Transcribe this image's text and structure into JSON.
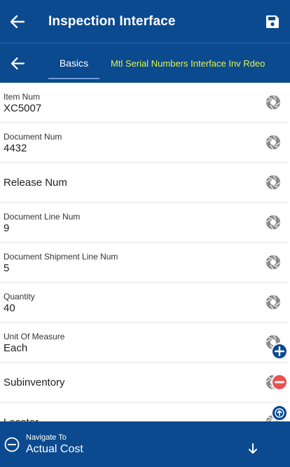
{
  "header": {
    "title": "Inspection Interface"
  },
  "tabs": {
    "basics_label": "Basics",
    "mtl_label": "Mtl Serial Numbers Interface Inv Rdeo"
  },
  "fields": [
    {
      "label": "Item Num",
      "value": "XC5007"
    },
    {
      "label": "Document Num",
      "value": "4432"
    },
    {
      "label": "Release Num",
      "value": ""
    },
    {
      "label": "Document Line Num",
      "value": "9"
    },
    {
      "label": "Document Shipment Line Num",
      "value": "5"
    },
    {
      "label": "Quantity",
      "value": "40"
    },
    {
      "label": "Unit Of Measure",
      "value": "Each"
    },
    {
      "label": "Subinventory",
      "value": ""
    },
    {
      "label": "Locator",
      "value": ""
    }
  ],
  "footer": {
    "navigate_label": "Navigate To",
    "navigate_value": "Actual Cost"
  },
  "colors": {
    "primary": "#0b4a8e",
    "tab_highlight": "#e1f24a",
    "remove": "#e9524f"
  },
  "icons": {
    "back": "arrow-left-icon",
    "save": "floppy-disk-icon",
    "field_action": "camera-shutter-icon",
    "add": "plus-icon",
    "remove": "minus-icon",
    "scroll_top": "arrow-up-icon",
    "nav_toggle": "minus-circle-icon",
    "nav_down": "arrow-down-icon"
  }
}
